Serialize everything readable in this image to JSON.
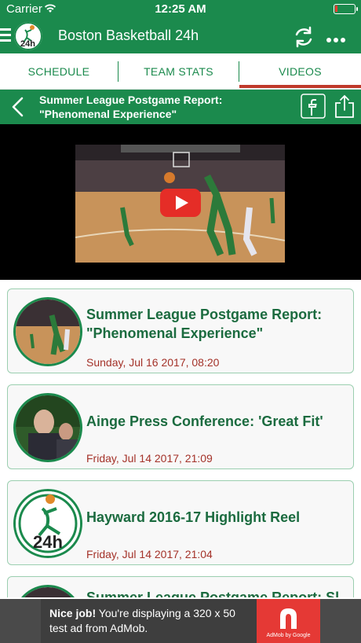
{
  "status": {
    "carrier": "Carrier",
    "time": "12:25 AM"
  },
  "app": {
    "title": "Boston Basketball 24h"
  },
  "tabs": [
    {
      "label": "SCHEDULE"
    },
    {
      "label": "TEAM STATS"
    },
    {
      "label": "VIDEOS"
    }
  ],
  "active_tab": "VIDEOS",
  "video": {
    "title": "Summer League Postgame Report: \"Phenomenal Experience\""
  },
  "videos": [
    {
      "title": "Summer League Postgame Report: \"Phenomenal Experience\"",
      "date": "Sunday, Jul 16 2017, 08:20"
    },
    {
      "title": "Ainge Press Conference: 'Great Fit'",
      "date": "Friday, Jul 14 2017, 21:09"
    },
    {
      "title": "Hayward 2016-17 Highlight Reel",
      "date": "Friday, Jul 14 2017, 21:04"
    },
    {
      "title": "Summer League Postgame Report: Sl",
      "date": ""
    }
  ],
  "ad": {
    "headline": "Nice job!",
    "body": " You're displaying a 320 x 50 test ad from AdMob.",
    "brand": "AdMob by Google"
  },
  "colors": {
    "brand_green": "#1b8a4d",
    "accent_red": "#c0392b",
    "date_red": "#a43229",
    "title_green": "#1b6b3f"
  },
  "icons": [
    "menu-icon",
    "app-logo",
    "refresh-icon",
    "more-icon",
    "back-icon",
    "facebook-icon",
    "share-icon",
    "play-icon",
    "admob-logo"
  ]
}
